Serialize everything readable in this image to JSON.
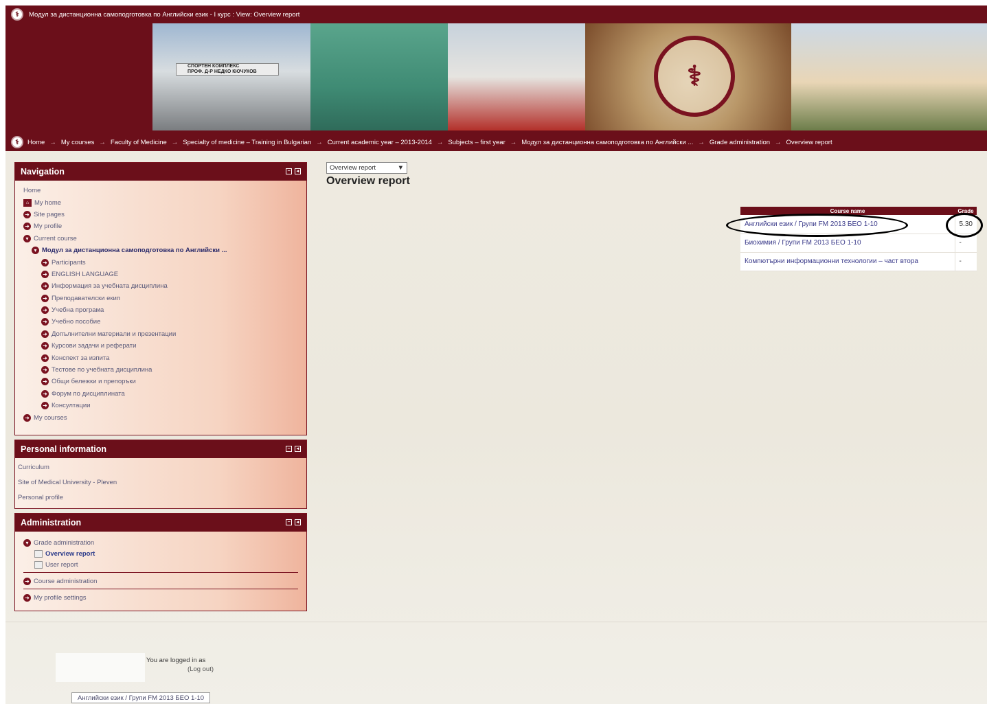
{
  "window_title": "Модул за дистанционна самоподготовка по Английски език - I курс : View: Overview report",
  "banner": {
    "sign_line1": "СПОРТЕН КОМПЛЕКС",
    "sign_line2": "ПРОФ. Д-Р НЕДКО КЮЧУКОВ",
    "seal_text": "МЕДИЦИНСКИ УНИВЕРСИТЕТ ПЛЕВЕН"
  },
  "breadcrumb": [
    "Home",
    "My courses",
    "Faculty of Medicine",
    "Specialty of medicine – Training in Bulgarian",
    "Current academic year – 2013-2014",
    "Subjects – first year",
    "Модул за дистанционна самоподготовка по Английски ...",
    "Grade administration",
    "Overview report"
  ],
  "breadcrumb_sep": "→",
  "navigation": {
    "title": "Navigation",
    "home": "Home",
    "my_home": "My home",
    "site_pages": "Site pages",
    "my_profile": "My profile",
    "current_course": "Current course",
    "course_name": "Модул за дистанционна самоподготовка по Английски ...",
    "course_items": [
      "Participants",
      "ENGLISH LANGUAGE",
      "Информация за учебната дисциплина",
      "Преподавателски екип",
      "Учебна програма",
      "Учебно пособие",
      "Допълнителни материали и презентации",
      "Курсови задачи и реферати",
      "Конспект за изпита",
      "Тестове по учебната дисциплина",
      "Общи бележки и препоръки",
      "Форум по дисциплината",
      "Консултации"
    ],
    "my_courses": "My courses"
  },
  "personal_info": {
    "title": "Personal information",
    "items": [
      "Curriculum",
      "Site of Medical University - Pleven",
      "Personal profile"
    ]
  },
  "administration": {
    "title": "Administration",
    "grade_admin": "Grade administration",
    "overview_report": "Overview report",
    "user_report": "User report",
    "course_admin": "Course administration",
    "profile_settings": "My profile settings"
  },
  "main": {
    "select_value": "Overview report",
    "page_title": "Overview report",
    "table_headers": [
      "Course name",
      "Grade"
    ],
    "rows": [
      {
        "course": "Английски език / Групи FM 2013 БЕО 1-10",
        "grade": "5.30"
      },
      {
        "course": "Биохимия / Групи FM 2013 БЕО 1-10",
        "grade": "-"
      },
      {
        "course": "Компютърни информационни технологии – част втора",
        "grade": "-"
      }
    ]
  },
  "footer": {
    "logged_in": "You are logged in as",
    "logout": "(Log out)",
    "course_button": "Английски език / Групи FM 2013 БЕО 1-10"
  },
  "colors": {
    "brand": "#6b0f1a",
    "block_bg_light": "#fbefe7",
    "block_bg_dark": "#efb49d"
  }
}
